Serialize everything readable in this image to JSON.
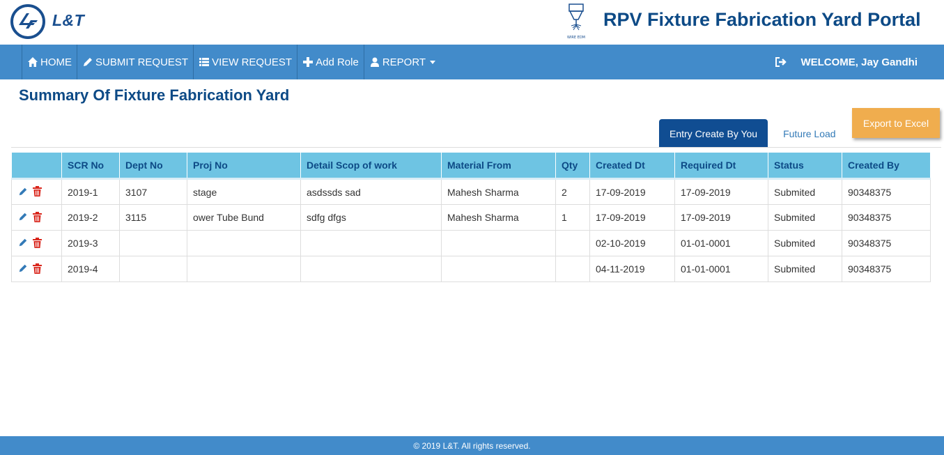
{
  "header": {
    "brand_text": "L&T",
    "portal_title": "RPV Fixture Fabrication Yard Portal",
    "edm_logo_text": "WIRE EDM"
  },
  "nav": {
    "items": [
      {
        "label": "HOME",
        "icon": "home-icon"
      },
      {
        "label": "SUBMIT REQUEST",
        "icon": "pencil-icon"
      },
      {
        "label": "VIEW REQUEST",
        "icon": "list-icon"
      },
      {
        "label": "Add Role",
        "icon": "plus-icon"
      },
      {
        "label": "REPORT",
        "icon": "user-icon"
      }
    ],
    "welcome": "WELCOME, Jay Gandhi"
  },
  "summary": {
    "title": "Summary Of Fixture Fabrication Yard",
    "tabs": [
      "Entry Create By You",
      "Future Load"
    ],
    "export_label": "Export to Excel"
  },
  "table": {
    "headers": [
      "",
      "SCR No",
      "Dept No",
      "Proj No",
      "Detail Scop of work",
      "Material From",
      "Qty",
      "Created Dt",
      "Required Dt",
      "Status",
      "Created By"
    ],
    "rows": [
      [
        "2019-1",
        "3107",
        "stage",
        "asdssds sad",
        "Mahesh Sharma",
        "2",
        "17-09-2019",
        "17-09-2019",
        "Submited",
        "90348375"
      ],
      [
        "2019-2",
        "3115",
        "ower Tube Bund",
        "sdfg dfgs",
        "Mahesh Sharma",
        "1",
        "17-09-2019",
        "17-09-2019",
        "Submited",
        "90348375"
      ],
      [
        "2019-3",
        "",
        "",
        "",
        "",
        "",
        "02-10-2019",
        "01-01-0001",
        "Submited",
        "90348375"
      ],
      [
        "2019-4",
        "",
        "",
        "",
        "",
        "",
        "04-11-2019",
        "01-01-0001",
        "Submited",
        "90348375"
      ]
    ]
  },
  "footer": {
    "text": "© 2019 L&T. All rights reserved."
  },
  "colors": {
    "navbar": "#428bca",
    "title": "#0d4a86",
    "table_header": "#6ec4e3",
    "tab_active": "#104d92",
    "export_button": "#f0ad4e",
    "delete_icon": "#d9261c"
  }
}
